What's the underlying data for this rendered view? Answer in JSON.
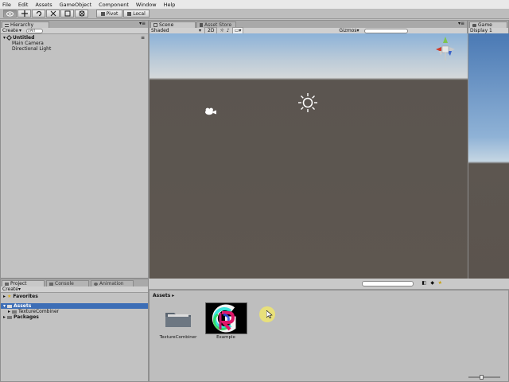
{
  "menu": [
    "File",
    "Edit",
    "Assets",
    "GameObject",
    "Component",
    "Window",
    "Help"
  ],
  "toolbar": {
    "pivot_label": "Pivot",
    "local_label": "Local"
  },
  "hierarchy": {
    "tab_label": "Hierarchy",
    "create_label": "Create",
    "search_placeholder": "All",
    "scene_name": "Untitled",
    "items": [
      "Main Camera",
      "Directional Light"
    ]
  },
  "scene": {
    "tab_label": "Scene",
    "tab2_label": "Asset Store",
    "shading_mode": "Shaded",
    "mode_2d": "2D",
    "gizmos_label": "Gizmos"
  },
  "game": {
    "tab_label": "Game",
    "display_label": "Display 1"
  },
  "project": {
    "tabs": [
      "Project",
      "Console",
      "Animation"
    ],
    "create_label": "Create",
    "favorites_label": "Favorites",
    "tree": [
      {
        "label": "Assets",
        "selected": true
      },
      {
        "label": "TextureCombiner",
        "selected": false
      },
      {
        "label": "Packages",
        "selected": false
      }
    ]
  },
  "assets_panel": {
    "breadcrumb": "Assets",
    "items": [
      {
        "label": "TextureCombiner",
        "icon": "folder-icon"
      },
      {
        "label": "Example",
        "icon": "texture-thumbnail"
      }
    ]
  },
  "colors": {
    "sky": "#bccbd8",
    "ground": "#5e5750",
    "selection": "#3d6eb6"
  }
}
